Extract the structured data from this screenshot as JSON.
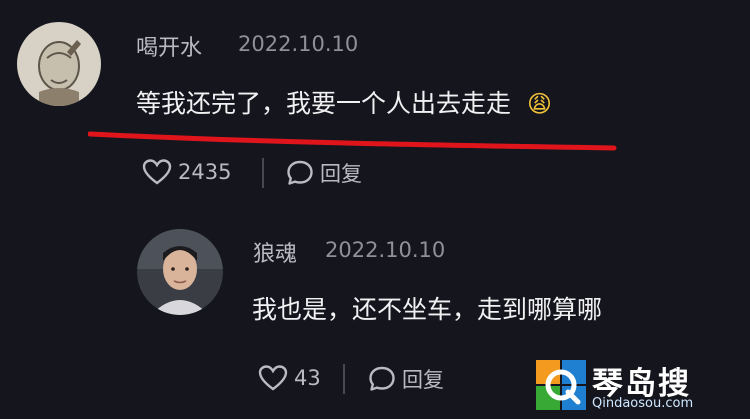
{
  "comment1": {
    "username": "喝开水",
    "date": "2022.10.10",
    "text": "等我还完了，我要一个人出去走走",
    "emoji": "😩",
    "likes": "2435",
    "reply_label": "回复"
  },
  "comment2": {
    "username": "狼魂",
    "date": "2022.10.10",
    "text": "我也是，还不坐车，走到哪算哪",
    "likes": "43",
    "reply_label": "回复"
  },
  "watermark": {
    "title": "琴岛搜",
    "url": "Qindaosou.com"
  },
  "colors": {
    "background": "#15161d",
    "underline": "#e0151c",
    "watermark_green": "#39a935",
    "watermark_blue": "#1f7fd0",
    "watermark_orange": "#f39a1f"
  },
  "icons": {
    "like": "heart-outline-icon",
    "reply": "speech-bubble-icon"
  }
}
